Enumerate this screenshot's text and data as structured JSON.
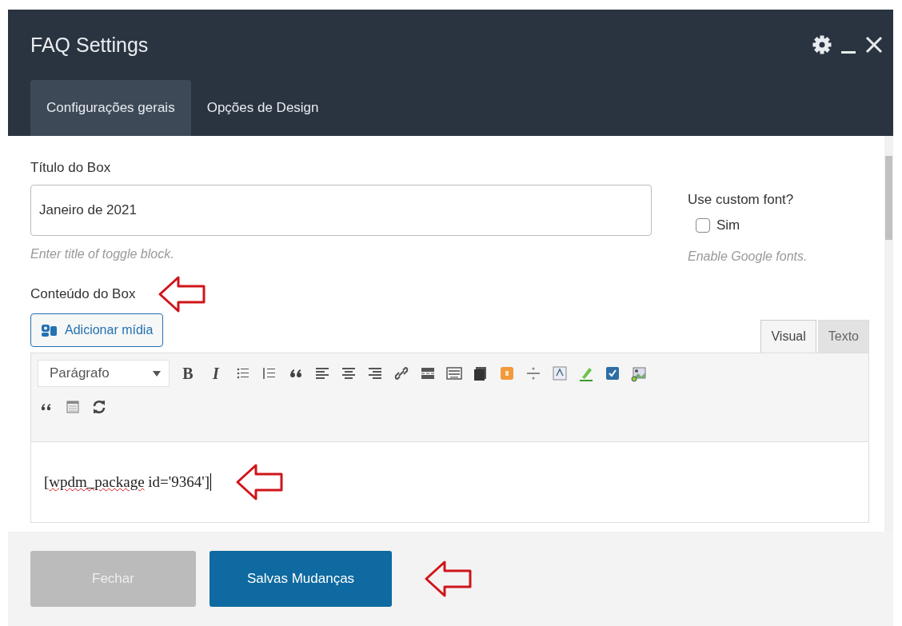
{
  "window": {
    "title": "FAQ Settings"
  },
  "tabs": [
    {
      "label": "Configurações gerais",
      "selected": true
    },
    {
      "label": "Opções de Design",
      "selected": false
    }
  ],
  "title_field": {
    "label": "Título do Box",
    "value": "Janeiro de 2021",
    "hint": "Enter title of toggle block."
  },
  "custom_font": {
    "label": "Use custom font?",
    "option": "Sim",
    "checked": false,
    "hint": "Enable Google fonts."
  },
  "content_label": "Conteúdo do Box",
  "media_button": "Adicionar mídia",
  "editor_tabs": [
    {
      "label": "Visual",
      "selected": true
    },
    {
      "label": "Texto",
      "selected": false
    }
  ],
  "toolbar": {
    "format": "Parágrafo",
    "text_buttons": [
      {
        "kind": "bold",
        "label": "B"
      },
      {
        "kind": "italic",
        "label": "I"
      }
    ]
  },
  "editor_content": {
    "before": "[",
    "misspelled_word": "wpdm_package",
    "after": " id='9364']"
  },
  "buttons": [
    {
      "label": "Fechar",
      "kind": "secondary"
    },
    {
      "label": "Salvas Mudanças",
      "kind": "primary"
    }
  ]
}
